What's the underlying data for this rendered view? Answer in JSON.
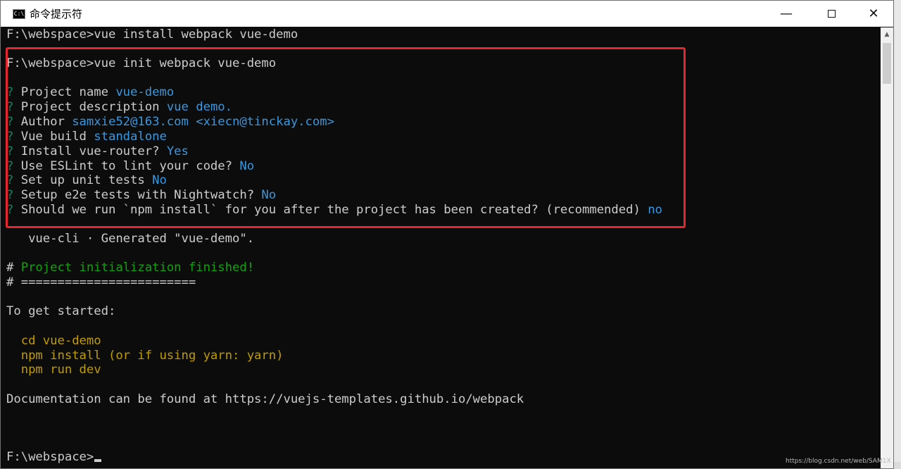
{
  "window": {
    "title": "命令提示符",
    "icon_text": "C:\\"
  },
  "console": {
    "lines": [
      {
        "prompt": "F:\\webspace>",
        "command": "vue install webpack vue-demo"
      },
      {
        "prompt": "F:\\webspace>",
        "command": "vue init webpack vue-demo"
      }
    ],
    "questions": [
      {
        "mark": "?",
        "label": " Project name ",
        "answer": "vue-demo"
      },
      {
        "mark": "?",
        "label": " Project description ",
        "answer": "vue demo."
      },
      {
        "mark": "?",
        "label": " Author ",
        "answer": "samxie52@163.com <xiecn@tinckay.com>"
      },
      {
        "mark": "?",
        "label": " Vue build ",
        "answer": "standalone"
      },
      {
        "mark": "?",
        "label": " Install vue-router? ",
        "answer": "Yes"
      },
      {
        "mark": "?",
        "label": " Use ESLint to lint your code? ",
        "answer": "No"
      },
      {
        "mark": "?",
        "label": " Set up unit tests ",
        "answer": "No"
      },
      {
        "mark": "?",
        "label": " Setup e2e tests with Nightwatch? ",
        "answer": "No"
      },
      {
        "mark": "?",
        "label": " Should we run `npm install` for you after the project has been created? (recommended) ",
        "answer": "no"
      }
    ],
    "generated": "   vue-cli · Generated \"vue-demo\".",
    "finished_hash": "# ",
    "finished_text": "Project initialization finished!",
    "separator": "# ========================",
    "get_started": "To get started:",
    "steps": [
      "  cd vue-demo",
      "  npm install (or if using yarn: yarn)",
      "  npm run dev"
    ],
    "docs": "Documentation can be found at https://vuejs-templates.github.io/webpack",
    "final_prompt": "F:\\webspace>"
  },
  "watermark": "https://blog.csdn.net/web/SAM1X",
  "colors": {
    "background": "#0c0c0c",
    "text": "#cccccc",
    "answer": "#3a96dd",
    "question_mark": "#1d7d5c",
    "success": "#13a10e",
    "instructions": "#c19c00",
    "highlight_border": "#e5262e"
  }
}
